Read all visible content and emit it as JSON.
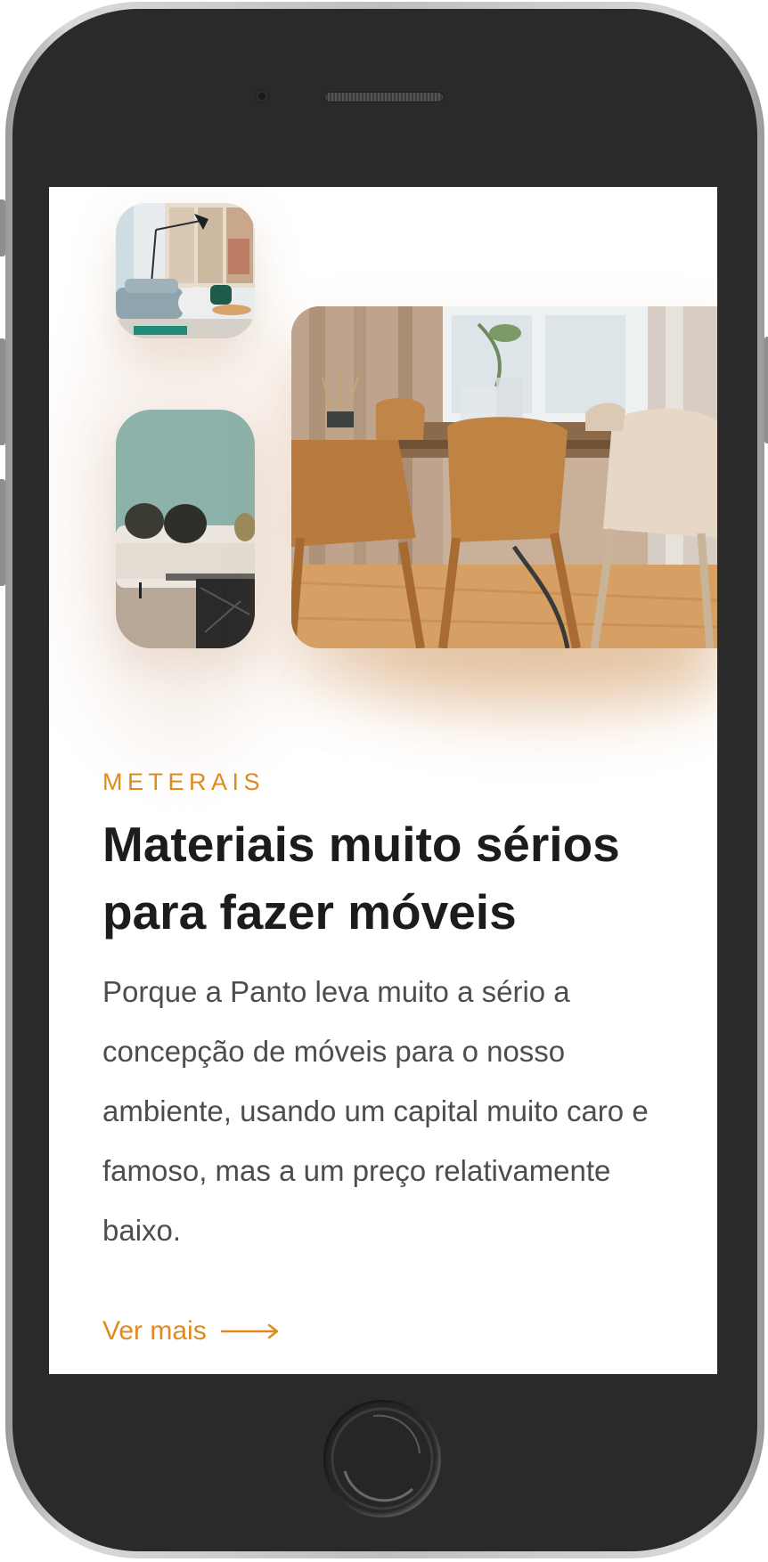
{
  "section": {
    "eyebrow": "METERAIS",
    "title": "Materiais muito sérios para fazer móveis",
    "description": "Porque a Panto leva muito a sério a concepção de móveis para o nosso ambiente, usando um capital muito caro e famoso, mas a um preço relativamente baixo.",
    "cta_label": "Ver mais",
    "cta_icon": "arrow-right-icon"
  },
  "images": [
    {
      "name": "living-room-photo",
      "subject": "living room with floor lamp"
    },
    {
      "name": "sofa-photo",
      "subject": "beige sofa with cushions and marble coffee table"
    },
    {
      "name": "dining-room-photo",
      "subject": "wooden dining chairs around table"
    }
  ],
  "colors": {
    "accent": "#e08a1e",
    "heading": "#1c1c1c",
    "body": "#4d4d4d",
    "phone_body": "#2a2a2a",
    "screen_bg": "#ffffff"
  }
}
